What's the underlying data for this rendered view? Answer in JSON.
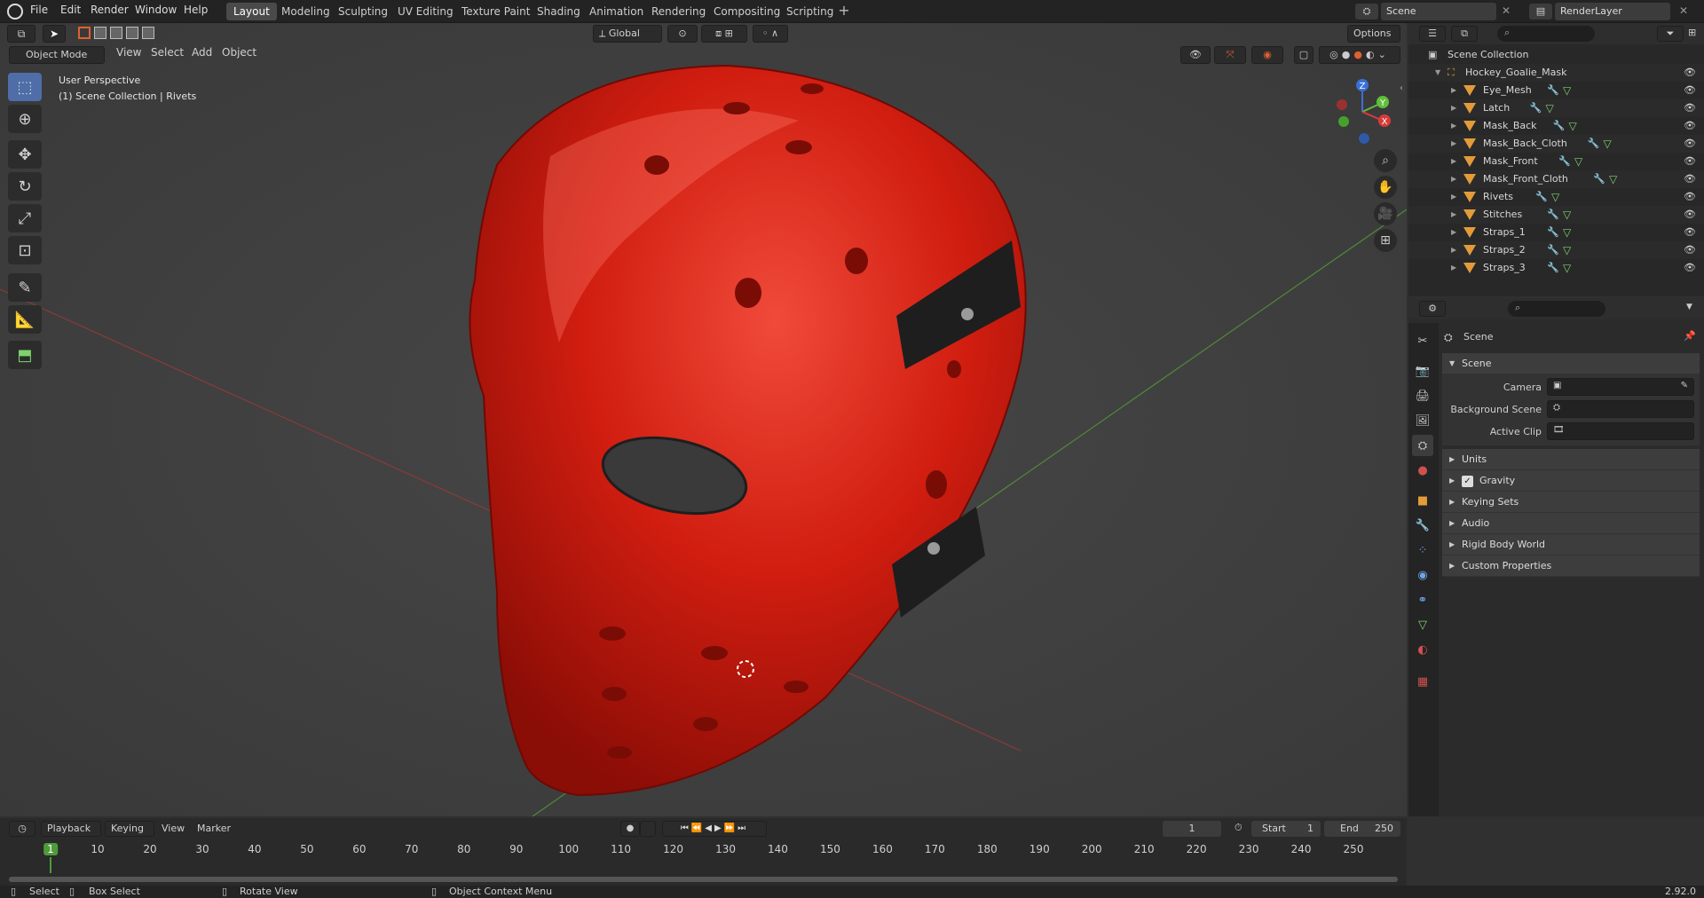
{
  "menus": [
    "File",
    "Edit",
    "Render",
    "Window",
    "Help"
  ],
  "workspaces": [
    "Layout",
    "Modeling",
    "Sculpting",
    "UV Editing",
    "Texture Paint",
    "Shading",
    "Animation",
    "Rendering",
    "Compositing",
    "Scripting"
  ],
  "workspace_active": "Layout",
  "scene_name": "Scene",
  "view_layer": "RenderLayer",
  "viewport": {
    "mode": "Object Mode",
    "menu": [
      "View",
      "Select",
      "Add",
      "Object"
    ],
    "orientation": "Global",
    "options": "Options",
    "overlay_line1": "User Perspective",
    "overlay_line2": "(1) Scene Collection | Rivets",
    "gizmo": {
      "z": "Z",
      "y": "Y",
      "x": "X"
    }
  },
  "outliner": {
    "root": "Scene Collection",
    "collection": "Hockey_Goalie_Mask",
    "objects": [
      "Eye_Mesh",
      "Latch",
      "Mask_Back",
      "Mask_Back_Cloth",
      "Mask_Front",
      "Mask_Front_Cloth",
      "Rivets",
      "Stitches",
      "Straps_1",
      "Straps_2",
      "Straps_3"
    ]
  },
  "properties": {
    "header": "Scene",
    "section_scene": "Scene",
    "camera_label": "Camera",
    "bg_scene_label": "Background Scene",
    "active_clip_label": "Active Clip",
    "sections": [
      "Units",
      "Gravity",
      "Keying Sets",
      "Audio",
      "Rigid Body World",
      "Custom Properties"
    ]
  },
  "timeline": {
    "menus": [
      "Playback",
      "Keying",
      "View",
      "Marker"
    ],
    "current_frame": "1",
    "start_label": "Start",
    "start": "1",
    "end_label": "End",
    "end": "250",
    "ticks": [
      "1",
      "10",
      "20",
      "30",
      "40",
      "50",
      "60",
      "70",
      "80",
      "90",
      "100",
      "110",
      "120",
      "130",
      "140",
      "150",
      "160",
      "170",
      "180",
      "190",
      "200",
      "210",
      "220",
      "230",
      "240",
      "250"
    ]
  },
  "status": {
    "select": "Select",
    "box_select": "Box Select",
    "rotate_view": "Rotate View",
    "context_menu": "Object Context Menu",
    "version": "2.92.0"
  },
  "colors": {
    "mask_red": "#d01d10",
    "accent_blue": "#4f6ea8",
    "mesh_orange": "#e39b3a"
  }
}
